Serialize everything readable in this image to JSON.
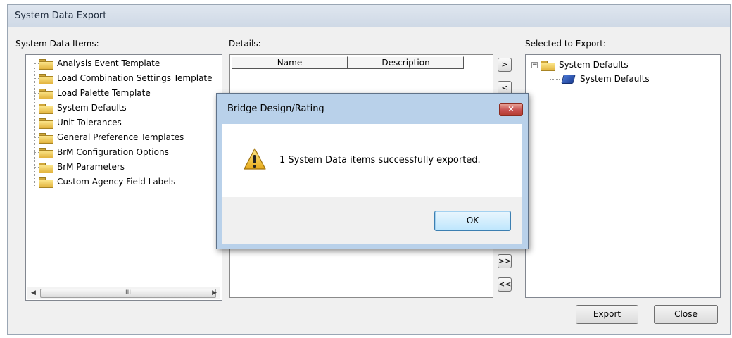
{
  "window": {
    "title": "System Data Export"
  },
  "left_panel": {
    "label": "System Data Items:",
    "items": [
      {
        "label": "Analysis Event Template",
        "open": false
      },
      {
        "label": "Load Combination Settings Template",
        "open": false
      },
      {
        "label": "Load Palette Template",
        "open": false
      },
      {
        "label": "System Defaults",
        "open": true
      },
      {
        "label": "Unit Tolerances",
        "open": false
      },
      {
        "label": "General Preference Templates",
        "open": false
      },
      {
        "label": "BrM Configuration Options",
        "open": false
      },
      {
        "label": "BrM Parameters",
        "open": false
      },
      {
        "label": "Custom Agency Field Labels",
        "open": false
      }
    ],
    "scroll_thumb": "III"
  },
  "details": {
    "label": "Details:",
    "columns": [
      "Name",
      "Description"
    ]
  },
  "move_buttons": {
    "add": ">",
    "remove": "<",
    "add_all": ">>",
    "remove_all": "<<"
  },
  "right_panel": {
    "label": "Selected to Export:",
    "root": "System Defaults",
    "expander": "−",
    "child": "System Defaults"
  },
  "buttons": {
    "export": "Export",
    "close": "Close"
  },
  "dialog": {
    "title": "Bridge Design/Rating",
    "close_glyph": "✕",
    "message": "1 System Data items successfully exported.",
    "ok": "OK"
  }
}
